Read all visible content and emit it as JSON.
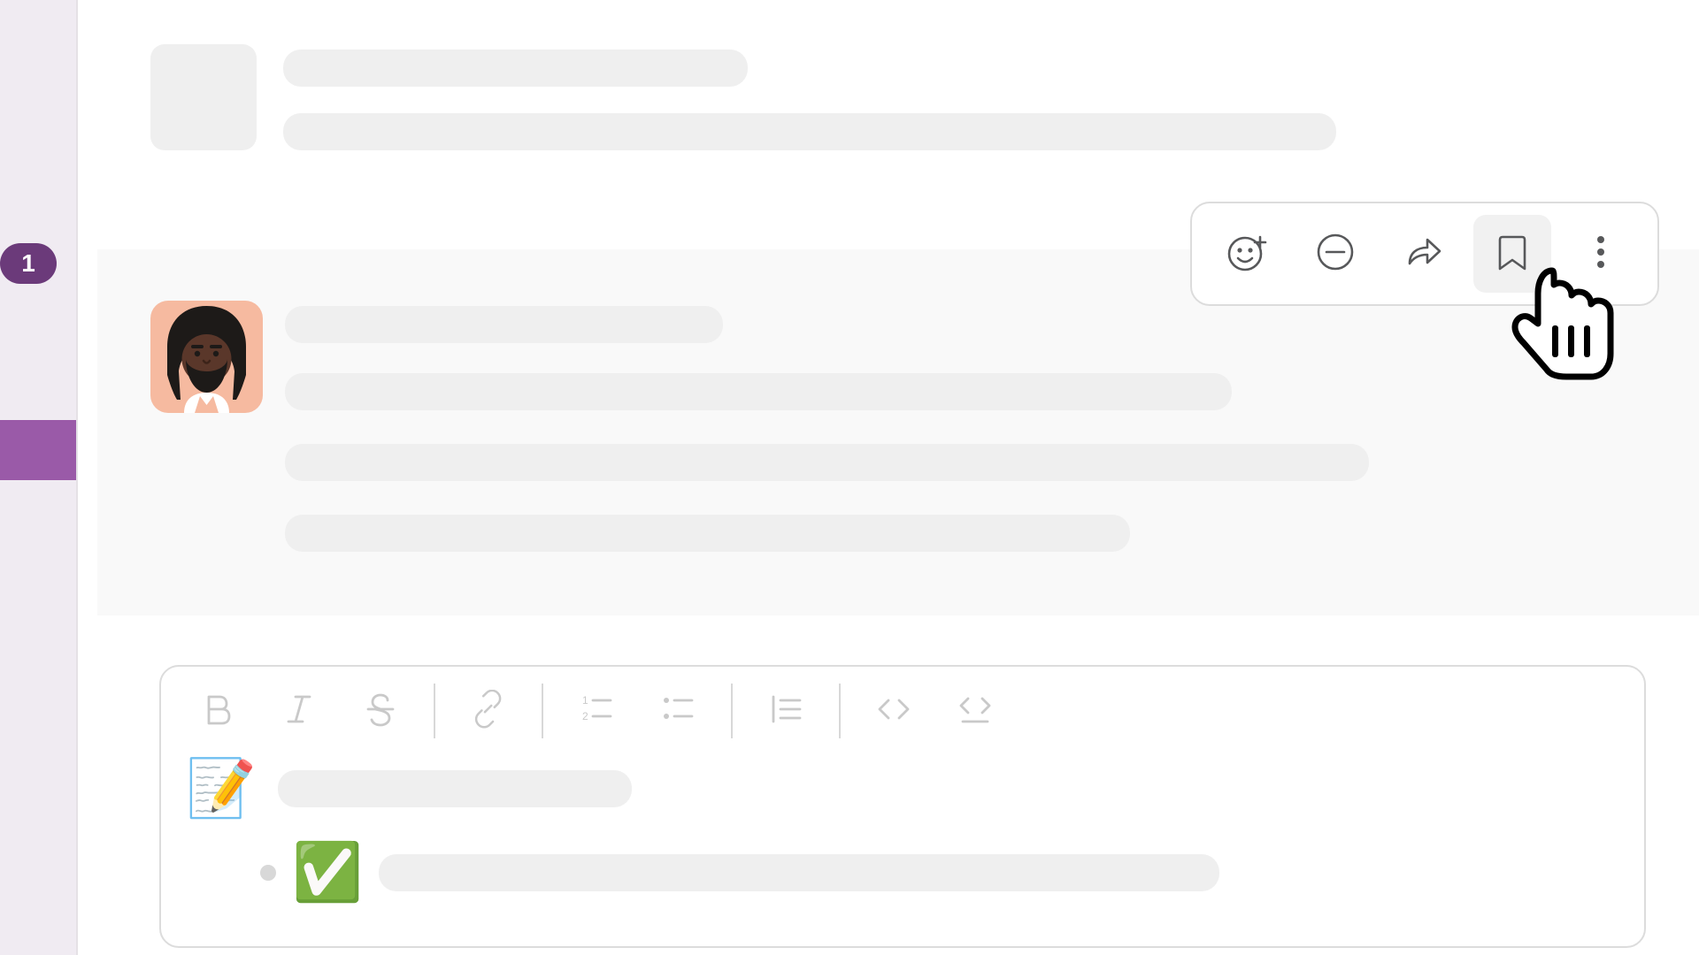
{
  "rail": {
    "badge": "1"
  },
  "message_actions": {
    "items": [
      {
        "name": "add-reaction-button",
        "icon": "emoji-plus-icon"
      },
      {
        "name": "reply-thread-button",
        "icon": "thread-icon"
      },
      {
        "name": "share-button",
        "icon": "share-arrow-icon"
      },
      {
        "name": "bookmark-button",
        "icon": "bookmark-icon",
        "hovered": true
      },
      {
        "name": "more-actions-button",
        "icon": "kebab-icon"
      }
    ]
  },
  "composer_toolbar": {
    "items": [
      "bold-icon",
      "italic-icon",
      "strikethrough-icon",
      "|",
      "link-icon",
      "|",
      "ordered-list-icon",
      "bullet-list-icon",
      "|",
      "blockquote-icon",
      "|",
      "code-icon",
      "code-block-icon"
    ]
  },
  "compose_content": {
    "line1_emoji": "📝",
    "line2_emoji": "✅"
  }
}
